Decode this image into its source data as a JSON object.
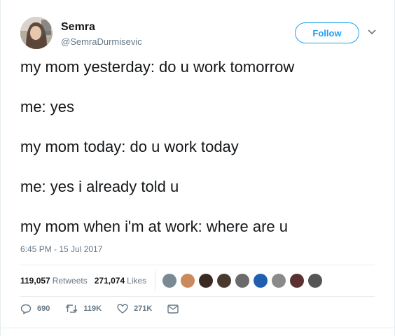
{
  "author": {
    "display_name": "Semra",
    "screen_name": "@SemraDurmisevic"
  },
  "follow_label": "Follow",
  "tweet_lines": [
    "my mom yesterday: do u work tomorrow",
    "me: yes",
    "my mom today: do u work today",
    "me: yes i already told u",
    "my mom when i'm at work: where are u"
  ],
  "timestamp": "6:45 PM - 15 Jul 2017",
  "stats": {
    "retweets_count": "119,057",
    "retweets_label": "Retweets",
    "likes_count": "271,074",
    "likes_label": "Likes"
  },
  "liker_avatars": [
    {
      "color": "#7a8a94"
    },
    {
      "color": "#c98a5e"
    },
    {
      "color": "#3a2a22"
    },
    {
      "color": "#4a3a2e"
    },
    {
      "color": "#6b6b6b"
    },
    {
      "color": "#1f5fae"
    },
    {
      "color": "#8a8a8a"
    },
    {
      "color": "#5a3030"
    },
    {
      "color": "#555555"
    }
  ],
  "actions": {
    "replies": "690",
    "retweets": "119K",
    "likes": "271K"
  },
  "colors": {
    "accent": "#1da1f2",
    "secondary_text": "#657786",
    "border": "#e6ecf0"
  }
}
